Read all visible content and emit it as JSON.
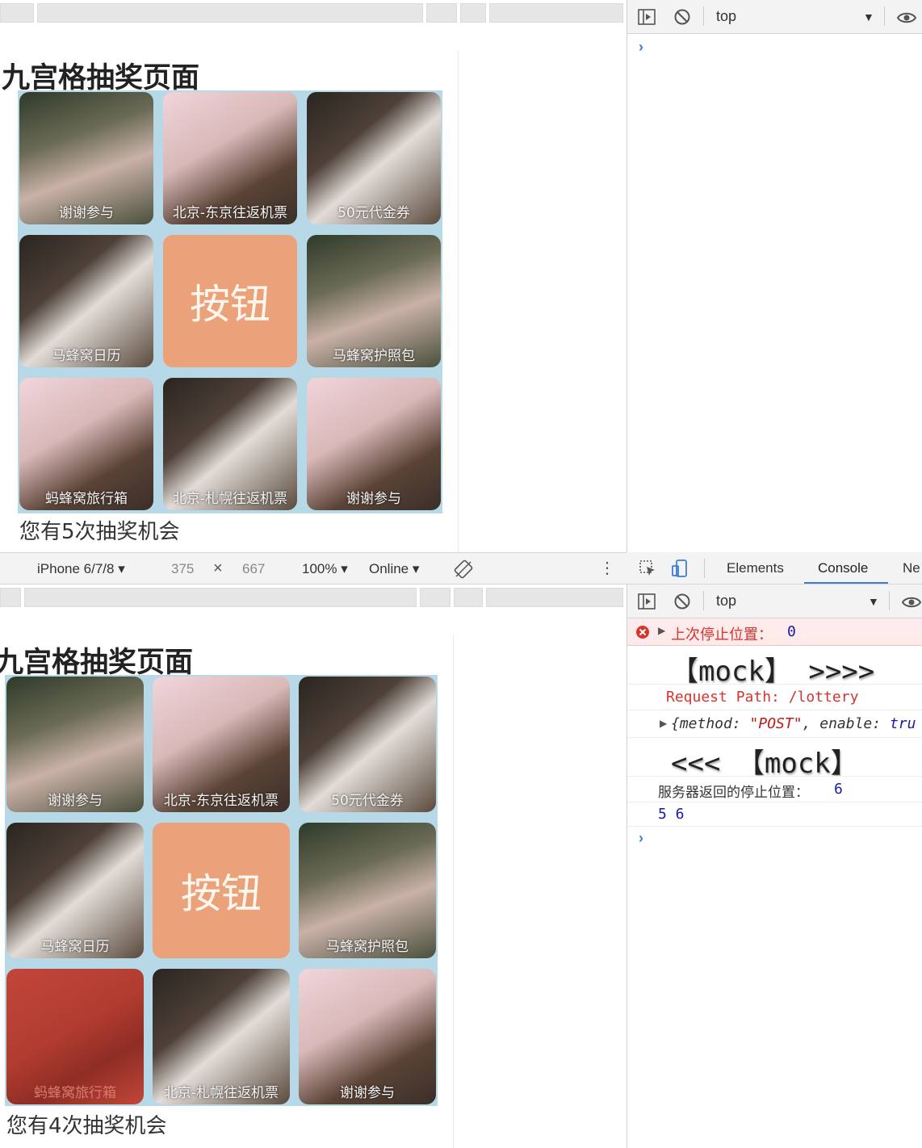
{
  "colors": {
    "grid_bg": "#b7d8e6",
    "button_bg": "#eba17a",
    "highlight": "#c2463a",
    "error_bg": "#fdeaea",
    "error_text": "#d8342c",
    "console_blue": "#1a1aa6"
  },
  "page": {
    "title": "九宫格抽奖页面",
    "button_label": "按钮",
    "prizes": [
      "谢谢参与",
      "北京-东京往返机票",
      "50元代金券",
      "马蜂窝日历",
      "马蜂窝护照包",
      "蚂蜂窝旅行箱",
      "北京-札幌往返机票",
      "谢谢参与"
    ],
    "chances_before": "您有5次抽奖机会",
    "chances_after": "您有4次抽奖机会"
  },
  "device_toolbar": {
    "device": "iPhone 6/7/8 ▾",
    "width": "375",
    "times": "×",
    "height": "667",
    "zoom": "100% ▾",
    "network": "Online ▾"
  },
  "devtools": {
    "context": "top",
    "tabs": [
      "Elements",
      "Console",
      "Ne"
    ],
    "active_tab": "Console",
    "console": {
      "error_label": "上次停止位置：",
      "error_value": "0",
      "mock_out": "【mock】 >>>>",
      "request_path": "Request Path: /lottery",
      "object_prefix": "{method: ",
      "object_method": "\"POST\"",
      "object_mid": ", enable: ",
      "object_enable": "tru",
      "mock_in": "<<< 【mock】",
      "server_label": "服务器返回的停止位置：",
      "server_value": "6",
      "numbers": "5 6"
    }
  }
}
